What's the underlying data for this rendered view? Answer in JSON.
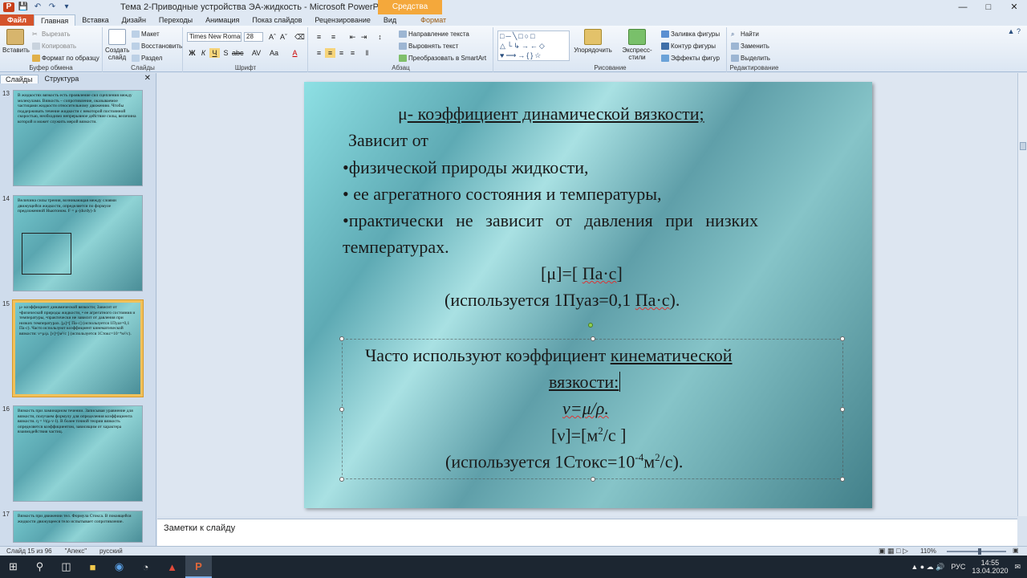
{
  "window": {
    "title": "Тема 2-Приводные устройства ЭА-жидкость - Microsoft PowerPoint",
    "context_tab": "Средства рисования",
    "controls": [
      "—",
      "□",
      "✕"
    ]
  },
  "ribbon_tabs": [
    "Файл",
    "Главная",
    "Вставка",
    "Дизайн",
    "Переходы",
    "Анимация",
    "Показ слайдов",
    "Рецензирование",
    "Вид",
    "Формат"
  ],
  "ribbon": {
    "clipboard": {
      "label": "Буфер обмена",
      "paste": "Вставить",
      "cut": "Вырезать",
      "copy": "Копировать",
      "format_painter": "Формат по образцу"
    },
    "slides": {
      "label": "Слайды",
      "new_slide": "Создать слайд",
      "layout": "Макет",
      "reset": "Восстановить",
      "section": "Раздел"
    },
    "font": {
      "label": "Шрифт",
      "font_name": "Times New Roman",
      "font_size": "28"
    },
    "paragraph": {
      "label": "Абзац",
      "text_direction": "Направление текста",
      "align_text": "Выровнять текст",
      "smartart": "Преобразовать в SmartArt"
    },
    "drawing": {
      "label": "Рисование",
      "arrange": "Упорядочить",
      "quick_styles": "Экспресс-стили",
      "fill": "Заливка фигуры",
      "outline": "Контур фигуры",
      "effects": "Эффекты фигур"
    },
    "editing": {
      "label": "Редактирование",
      "find": "Найти",
      "replace": "Заменить",
      "select": "Выделить"
    }
  },
  "left_pane": {
    "tabs": [
      "Слайды",
      "Структура"
    ],
    "thumbnails": [
      {
        "num": "13",
        "text": "В жидкостях вязкость есть проявление сил сцепления между молекулами. Вязкость – сопротивление, оказываемое частицами жидкости относительному движению. Чтобы поддерживать течение жидкости с некоторой постоянной скоростью, необходимо непрерывное действие силы, величина которой и может служить мерой вязкости."
      },
      {
        "num": "14",
        "text": "Величина силы трения, возникающая между слоями движущейся жидкости, определяется по формуле предложенной Ньютоном. F = μ·(du/dy)·S"
      },
      {
        "num": "15",
        "text": "μ- коэффициент динамической вязкости; Зависит от •физической природы жидкости, • ее агрегатного состояния и температуры, •практически не зависит от давления при низких температурах. [μ]=[ Па·с] (используется 1Пуаз=0,1 Па·с). Часто используют коэффициент кинематической вязкости: ν=μ/ρ. [ν]=[м²/с ] (используется 1Стокс=10⁻⁴м²/с)."
      },
      {
        "num": "16",
        "text": "Вязкость при ламинарном течении. Записывая уравнение для вязкости, получаем формулу для определения коэффициента вязкости. η = ⅓(ρ·v·l). В более точной теории вязкость определяется коэффициентом, зависящим от характера взаимодействия частиц."
      },
      {
        "num": "17",
        "text": "Вязкость при движении тел. Формула Стокса. В покоящейся жидкости движущееся тело испытывает сопротивление."
      }
    ]
  },
  "slide": {
    "title_mu": "μ",
    "title_rest": "- коэффициент динамической вязкости;",
    "line1": "Зависит от",
    "line2": "•физической природы жидкости,",
    "line3": "• ее агрегатного состояния и температуры,",
    "line4": "•практически не зависит от давления при низких",
    "line5": "температурах.",
    "unit_left": "[μ]=[ ",
    "unit_pa": "Па·с",
    "unit_right": "]",
    "uses_left": "(используется 1Пуаз=0,1 ",
    "uses_pa": "Па·с",
    "uses_right": ").",
    "kin_line1_a": "Часто используют коэффициент ",
    "kin_line1_b": "кинематической",
    "kin_line2": "вязкости:",
    "formula": "ν=μ/ρ.",
    "kin_unit_a": "[ν]=[м",
    "kin_unit_sup": "2",
    "kin_unit_b": "/с ]",
    "stokes_a": "(используется 1Стокс=10",
    "stokes_sup": "-4",
    "stokes_b": "м",
    "stokes_sup2": "2",
    "stokes_c": "/с)."
  },
  "notes": {
    "placeholder": "Заметки к слайду"
  },
  "status": {
    "slide_counter": "Слайд 15 из 96",
    "theme": "\"Апекс\"",
    "language": "русский",
    "zoom": "110%",
    "zoom_level_percent": 55
  },
  "taskbar": {
    "time": "14:55",
    "date": "13.04.2020",
    "lang": "РУС"
  },
  "colors": {
    "file_tab": "#d4532b",
    "context_tab": "#f4a83b",
    "slide_teal": "#5eaab4"
  }
}
